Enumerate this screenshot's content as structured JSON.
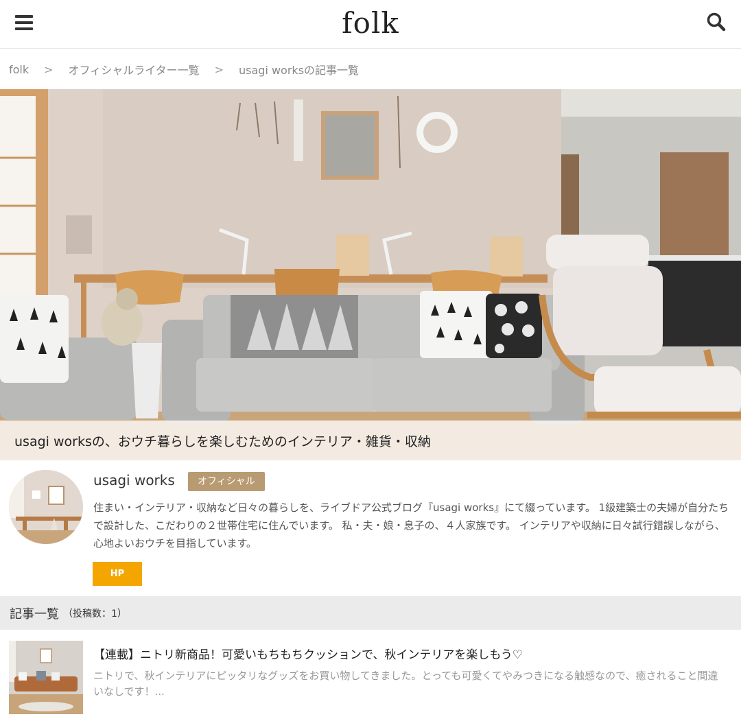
{
  "header": {
    "logo": "folk"
  },
  "breadcrumb": {
    "items": [
      "folk",
      "オフィシャルライター一覧",
      "usagi worksの記事一覧"
    ],
    "separator": ">"
  },
  "hero": {
    "caption": "usagi worksの、おウチ暮らしを楽しむためのインテリア・雑貨・収納"
  },
  "profile": {
    "name": "usagi works",
    "badge": "オフィシャル",
    "bio": "住まい・インテリア・収納など日々の暮らしを、ライブドア公式ブログ『usagi works』にて綴っています。 1級建築士の夫婦が自分たちで設計した、こだわりの２世帯住宅に住んでいます。 私・夫・娘・息子の、４人家族です。 インテリアや収納に日々試行錯誤しながら、心地よいおウチを目指しています。",
    "hp_label": "HP"
  },
  "articles": {
    "heading": "記事一覧",
    "count_label": "（投稿数：1）",
    "items": [
      {
        "title": "【連載】ニトリ新商品！可愛いもちもちクッションで、秋インテリアを楽しもう♡",
        "excerpt": "ニトリで、秋インテリアにピッタリなグッズをお買い物してきました。とっても可愛くてやみつきになる触感なので、癒されること間違いなしです！..."
      }
    ]
  },
  "colors": {
    "badge": "#b89b72",
    "hp_button": "#f5a500",
    "section_bar": "#ebebeb"
  },
  "icons": [
    "menu-icon",
    "search-icon"
  ]
}
